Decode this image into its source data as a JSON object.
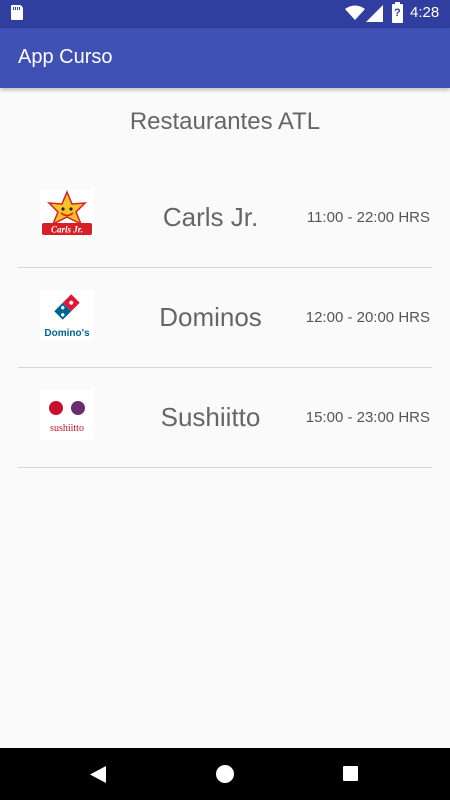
{
  "status_bar": {
    "time": "4:28",
    "battery_level": "?",
    "icons": [
      "sd-card-icon",
      "wifi-icon",
      "signal-icon",
      "battery-icon"
    ]
  },
  "app_bar": {
    "title": "App Curso"
  },
  "main": {
    "title": "Restaurantes ATL",
    "restaurants": [
      {
        "name": "Carls Jr.",
        "hours": "11:00 - 22:00 HRS",
        "logo_text": "Carls Jr."
      },
      {
        "name": "Dominos",
        "hours": "12:00 - 20:00 HRS",
        "logo_text": "Domino's"
      },
      {
        "name": "Sushiitto",
        "hours": "15:00 - 23:00 HRS",
        "logo_text": "sushiitto"
      }
    ]
  },
  "nav_bar": {
    "icons": [
      "back-icon",
      "home-icon",
      "recents-icon"
    ]
  },
  "colors": {
    "status_bar": "#303f9f",
    "app_bar": "#3f51b5",
    "background": "#fafafa",
    "divider": "#d6d6d6"
  }
}
